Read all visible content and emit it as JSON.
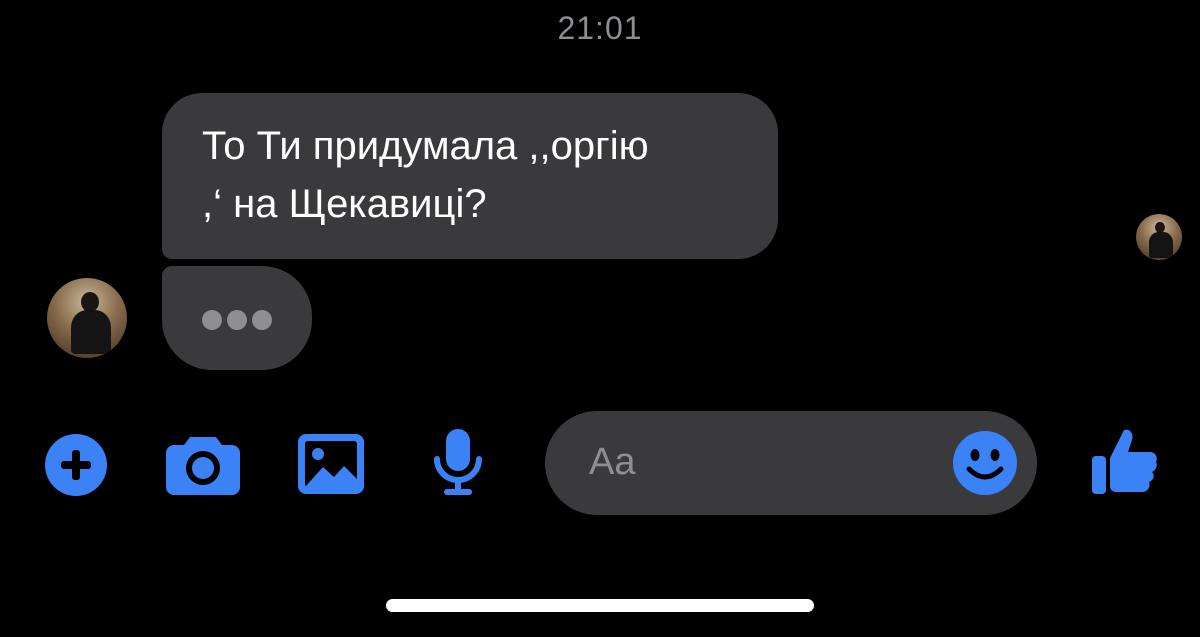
{
  "chat": {
    "timestamp": "21:01",
    "incoming_message": "То Ти придумала ,,оргію\n,‘ на Щекавиці?",
    "typing_indicator": "typing-dots"
  },
  "composer": {
    "placeholder": "Aa",
    "icons": [
      "plus-icon",
      "camera-icon",
      "image-icon",
      "microphone-icon",
      "emoji-icon",
      "thumbs-up-icon"
    ]
  },
  "colors": {
    "background": "#000000",
    "bubble": "#3a3a3c",
    "accent": "#3b82f6",
    "secondary_text": "#8e8e93"
  }
}
